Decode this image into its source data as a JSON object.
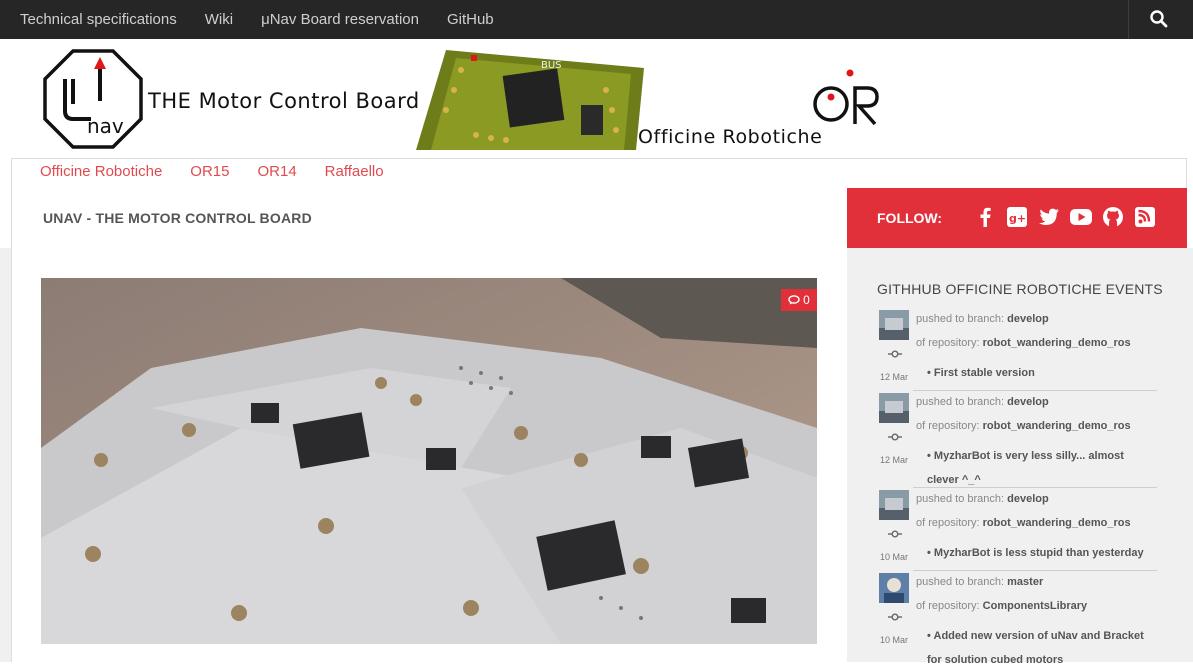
{
  "topnav": {
    "items": [
      "Technical specifications",
      "Wiki",
      "μNav Board reservation",
      "GitHub"
    ],
    "search_icon": "search-icon"
  },
  "banner": {
    "logo_text": "μnav",
    "title": "THE Motor Control Board",
    "or_mark": "OR",
    "or_subtitle": "Officine Robotiche"
  },
  "subnav": {
    "items": [
      "Officine Robotiche",
      "OR15",
      "OR14",
      "Raffaello"
    ]
  },
  "page": {
    "title": "UNAV - THE MOTOR CONTROL BOARD",
    "comment_count": "0"
  },
  "follow": {
    "label": "FOLLOW:",
    "icons": [
      "facebook-icon",
      "google-plus-icon",
      "twitter-icon",
      "youtube-icon",
      "github-icon",
      "rss-icon"
    ]
  },
  "sidebar": {
    "title": "GITHHUB OFFICINE ROBOTICHE EVENTS",
    "events": [
      {
        "pushed_prefix": "pushed to branch:",
        "branch": "develop",
        "repo_prefix": "of repository:",
        "repo": "robot_wandering_demo_ros",
        "message": "First stable version",
        "date": "12 Mar"
      },
      {
        "pushed_prefix": "pushed to branch:",
        "branch": "develop",
        "repo_prefix": "of repository:",
        "repo": "robot_wandering_demo_ros",
        "message": "MyzharBot is very less silly... almost clever ^_^",
        "date": "12 Mar"
      },
      {
        "pushed_prefix": "pushed to branch:",
        "branch": "develop",
        "repo_prefix": "of repository:",
        "repo": "robot_wandering_demo_ros",
        "message": "MyzharBot is less stupid than yesterday",
        "date": "10 Mar"
      },
      {
        "pushed_prefix": "pushed to branch:",
        "branch": "master",
        "repo_prefix": "of repository:",
        "repo": "ComponentsLibrary",
        "message": "Added new version of uNav and Bracket for solution cubed motors",
        "date": "10 Mar"
      }
    ]
  },
  "colors": {
    "accent": "#e2303b",
    "link": "#e24a4f",
    "topbar": "#262626"
  }
}
